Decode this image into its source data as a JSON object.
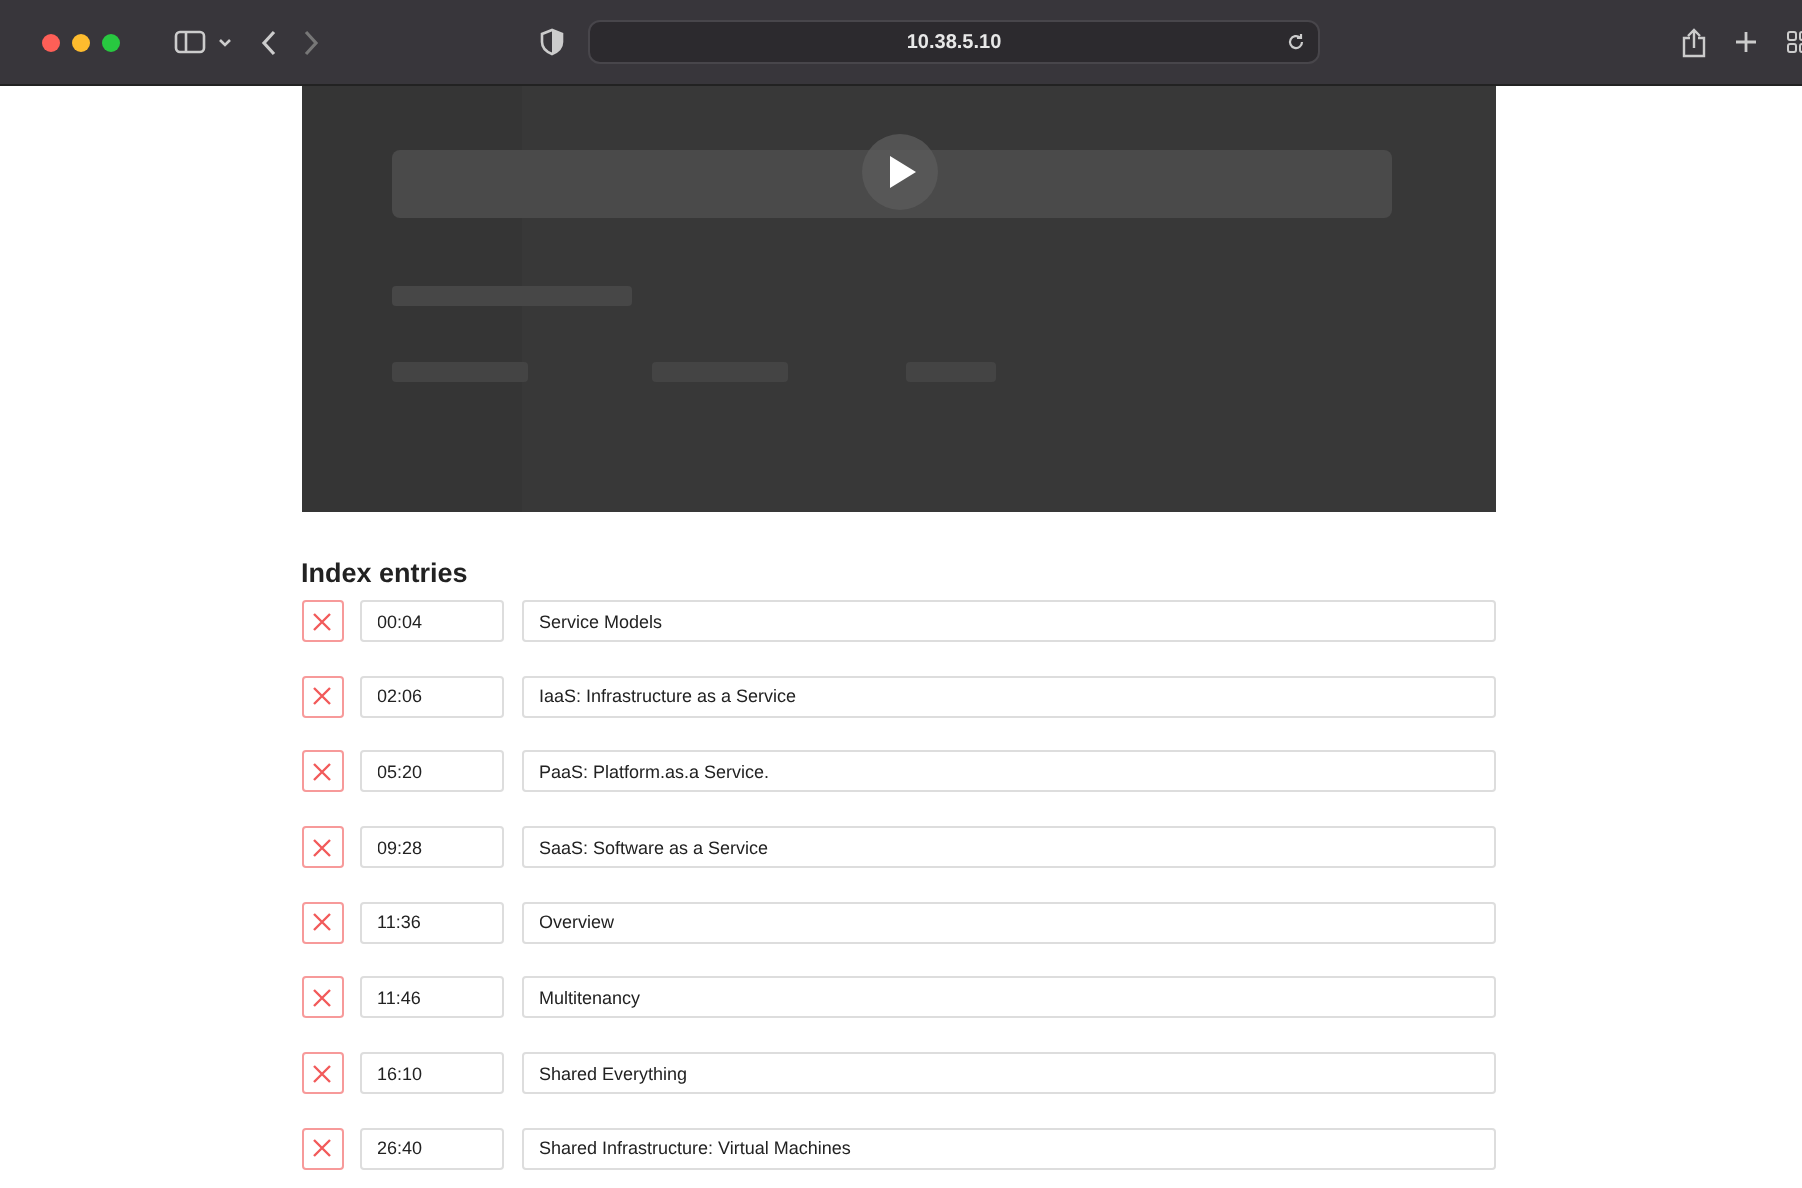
{
  "browser": {
    "url": "10.38.5.10"
  },
  "index": {
    "heading": "Index entries",
    "entries": [
      {
        "time": "00:04",
        "title": "Service Models"
      },
      {
        "time": "02:06",
        "title": "IaaS: Infrastructure as a Service"
      },
      {
        "time": "05:20",
        "title": "PaaS: Platform.as.a Service."
      },
      {
        "time": "09:28",
        "title": "SaaS: Software as a Service"
      },
      {
        "time": "11:36",
        "title": "Overview"
      },
      {
        "time": "11:46",
        "title": "Multitenancy"
      },
      {
        "time": "16:10",
        "title": "Shared Everything"
      },
      {
        "time": "26:40",
        "title": "Shared Infrastructure: Virtual Machines"
      }
    ]
  }
}
